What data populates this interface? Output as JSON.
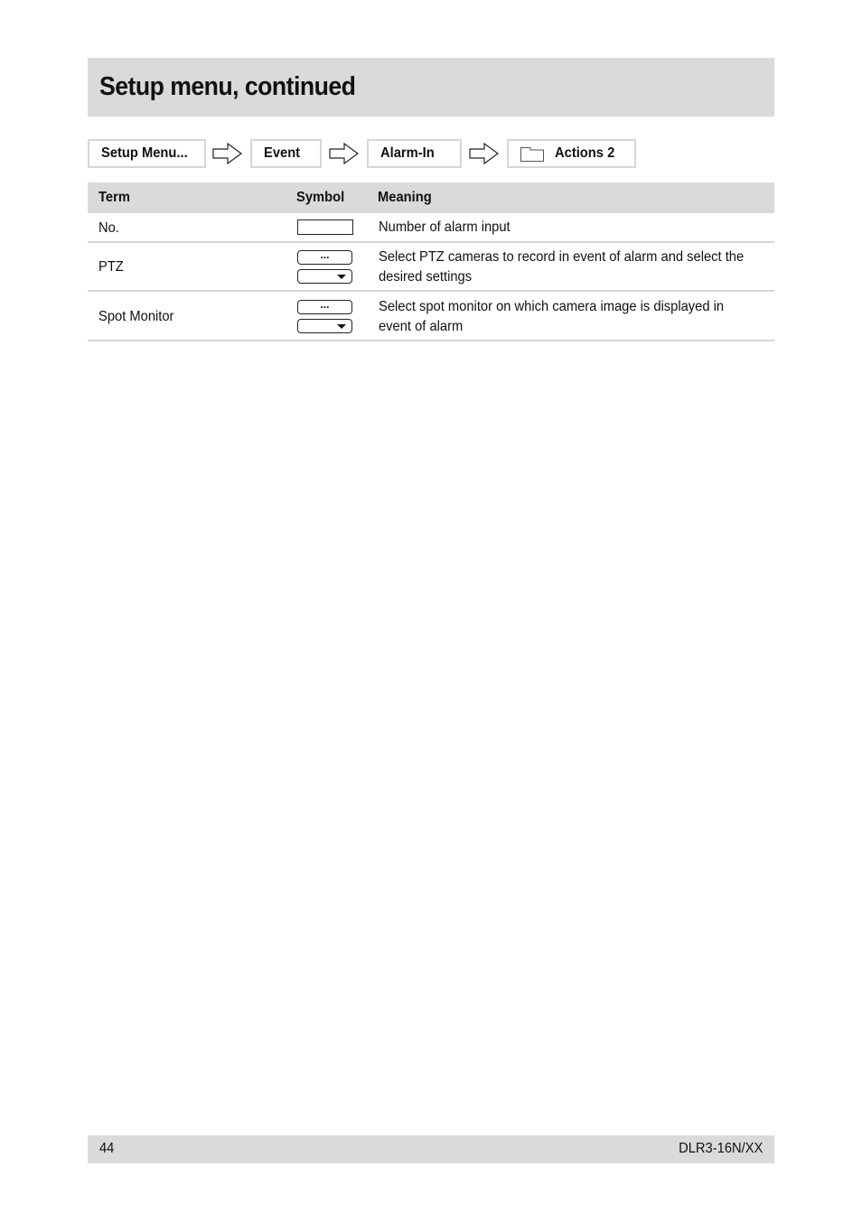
{
  "header": {
    "title": "Setup menu, continued"
  },
  "breadcrumb": {
    "items": [
      {
        "label": "Setup Menu..."
      },
      {
        "label": "Event"
      },
      {
        "label": "Alarm-In"
      },
      {
        "label": "Actions 2",
        "icon": "folder-icon"
      }
    ],
    "separator_icon": "arrow-right-outline-icon"
  },
  "table": {
    "columns": [
      "Term",
      "Symbol",
      "Meaning"
    ],
    "rows": [
      {
        "term": "No.",
        "symbol": "text-field",
        "meaning": "Number of alarm input"
      },
      {
        "term": "PTZ",
        "symbol": "button-and-dropdown",
        "button_label": "...",
        "meaning": "Select PTZ cameras to record in event of alarm and select the desired settings"
      },
      {
        "term": "Spot Monitor",
        "symbol": "button-and-dropdown",
        "button_label": "...",
        "meaning": "Select spot monitor on which camera image is displayed in event of alarm"
      }
    ]
  },
  "footer": {
    "page_number": "44",
    "model": "DLR3-16N/XX"
  },
  "colors": {
    "band_gray": "#d9dadb",
    "border_gray": "#d6d6d6",
    "text": "#111111"
  }
}
